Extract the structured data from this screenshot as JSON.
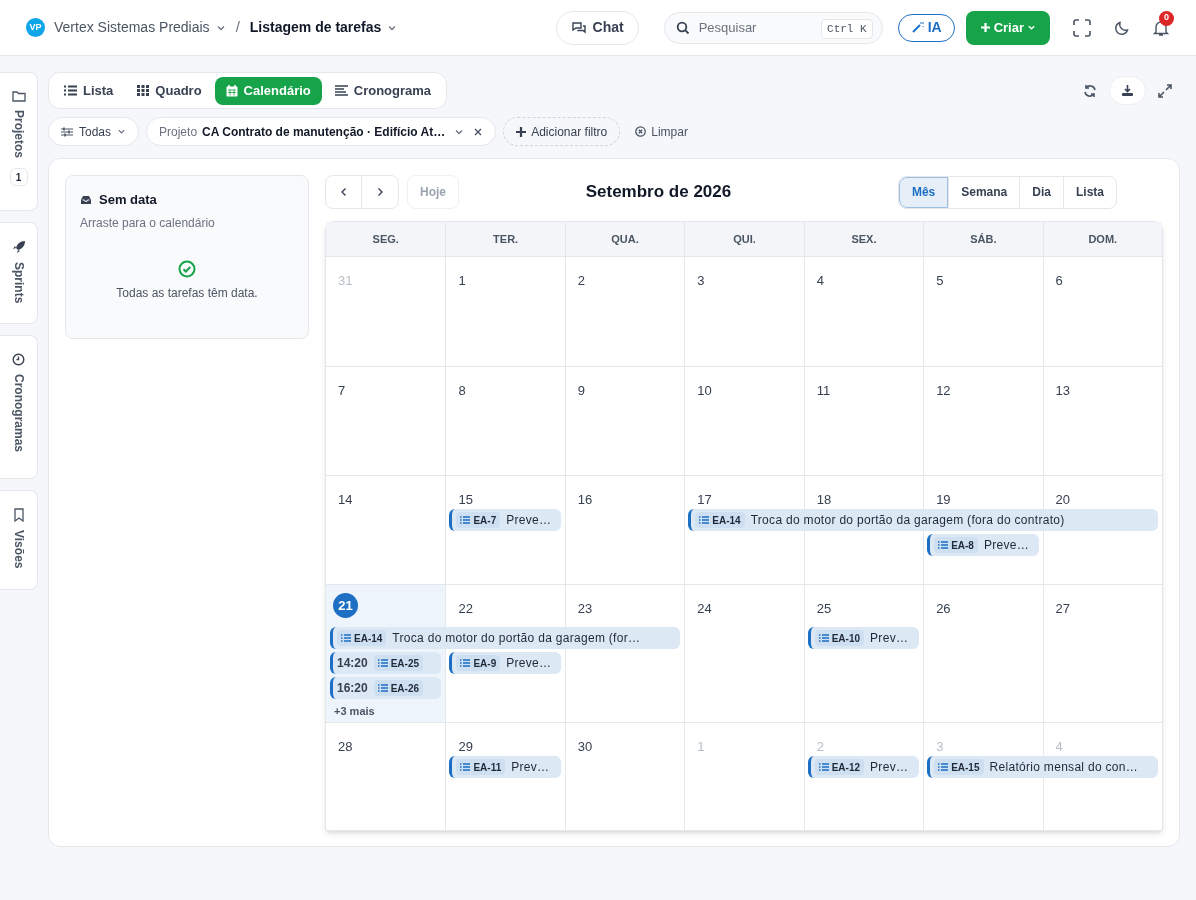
{
  "header": {
    "org_initials": "VP",
    "org": "Vertex Sistemas Prediais",
    "separator": "/",
    "page": "Listagem de tarefas",
    "chat": "Chat",
    "search": {
      "placeholder": "Pesquisar",
      "shortcut": "Ctrl K"
    },
    "ai": "IA",
    "create": "Criar",
    "notifications": "0"
  },
  "side_tabs": [
    {
      "label": "Projetos",
      "badge": "1"
    },
    {
      "label": "Sprints"
    },
    {
      "label": "Cronogramas"
    },
    {
      "label": "Visões"
    }
  ],
  "view_tabs": [
    {
      "label": "Lista",
      "selected": false
    },
    {
      "label": "Quadro",
      "selected": false
    },
    {
      "label": "Calendário",
      "selected": true
    },
    {
      "label": "Cronograma",
      "selected": false
    }
  ],
  "filters": {
    "scope": "Todas",
    "project_label": "Projeto",
    "project_value": "CA Contrato de manutenção · Edifício At…",
    "add": "Adicionar filtro",
    "clear": "Limpar"
  },
  "undated": {
    "title": "Sem data",
    "subtitle": "Arraste para o calendário",
    "message": "Todas as tarefas têm data."
  },
  "calendar": {
    "today_button": {
      "label": "Hoje",
      "disabled": true
    },
    "title": "Setembro de 2026",
    "modes": [
      {
        "label": "Mês",
        "selected": true
      },
      {
        "label": "Semana",
        "selected": false
      },
      {
        "label": "Dia",
        "selected": false
      },
      {
        "label": "Lista",
        "selected": false
      }
    ],
    "weekdays": [
      "SEG.",
      "TER.",
      "QUA.",
      "QUI.",
      "SEX.",
      "SÁB.",
      "DOM."
    ],
    "weeks": [
      {
        "days": [
          {
            "label": "31",
            "outside": true
          },
          {
            "label": "1"
          },
          {
            "label": "2"
          },
          {
            "label": "3"
          },
          {
            "label": "4"
          },
          {
            "label": "5"
          },
          {
            "label": "6"
          }
        ]
      },
      {
        "days": [
          {
            "label": "7"
          },
          {
            "label": "8"
          },
          {
            "label": "9"
          },
          {
            "label": "10"
          },
          {
            "label": "11"
          },
          {
            "label": "12"
          },
          {
            "label": "13"
          }
        ]
      },
      {
        "days": [
          {
            "label": "14"
          },
          {
            "label": "15",
            "events": [
              {
                "code": "EA-7",
                "title": "Preve…"
              }
            ]
          },
          {
            "label": "16"
          },
          {
            "label": "17",
            "events": [
              {
                "code": "EA-14",
                "title": "Troca do motor do portão da garagem (fora do contrato)"
              }
            ]
          },
          {
            "label": "18",
            "events": [
              {
                "continued": true
              }
            ]
          },
          {
            "label": "19",
            "events": [
              {
                "continued": true
              },
              {
                "code": "EA-8",
                "title": "Preve…"
              }
            ]
          },
          {
            "label": "20",
            "events": [
              {
                "continued": true
              }
            ]
          }
        ]
      },
      {
        "days": [
          {
            "label": "21",
            "today": true,
            "events": [
              {
                "code": "EA-14",
                "title": "Troca do motor do portão da garagem (for…"
              },
              {
                "time": "14:20",
                "code": "EA-25"
              },
              {
                "time": "16:20",
                "code": "EA-26"
              }
            ],
            "more": "+3 mais"
          },
          {
            "label": "22",
            "events": [
              {
                "continued": true
              },
              {
                "code": "EA-9",
                "title": "Preve…"
              }
            ]
          },
          {
            "label": "23",
            "events": [
              {
                "continued": true
              }
            ]
          },
          {
            "label": "24"
          },
          {
            "label": "25",
            "events": [
              {
                "code": "EA-10",
                "title": "Prev…"
              }
            ]
          },
          {
            "label": "26"
          },
          {
            "label": "27"
          }
        ]
      },
      {
        "days": [
          {
            "label": "28"
          },
          {
            "label": "29",
            "events": [
              {
                "code": "EA-11",
                "title": "Prev…"
              }
            ]
          },
          {
            "label": "30"
          },
          {
            "label": "1",
            "outside": true
          },
          {
            "label": "2",
            "outside": true,
            "events": [
              {
                "code": "EA-12",
                "title": "Prev…"
              }
            ]
          },
          {
            "label": "3",
            "outside": true,
            "events": [
              {
                "code": "EA-15",
                "title": "Relatório mensal do con…"
              }
            ]
          },
          {
            "label": "4",
            "outside": true,
            "events": [
              {
                "continued": true
              }
            ]
          }
        ]
      }
    ]
  }
}
